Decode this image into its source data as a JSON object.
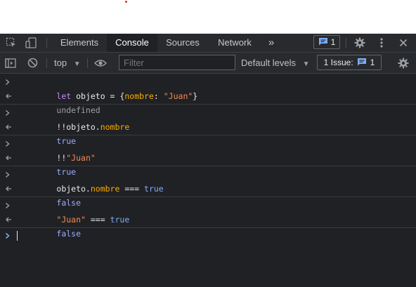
{
  "tabs": {
    "elements": "Elements",
    "console": "Console",
    "sources": "Sources",
    "network": "Network",
    "more": "»",
    "messages_count": "1"
  },
  "toolbar": {
    "context": "top",
    "filter_placeholder": "Filter",
    "levels": "Default levels",
    "issues_label": "1 Issue:",
    "issues_count": "1"
  },
  "console": {
    "entries": [
      {
        "input": {
          "t1": "let objeto = {",
          "t2": "nombre",
          "t3": ": ",
          "t4": "\"Juan\"",
          "t5": "}"
        },
        "output": "undefined"
      },
      {
        "input": {
          "t1": "!!objeto.",
          "t2": "nombre"
        },
        "output": "true"
      },
      {
        "input": {
          "t1": "!!",
          "t2": "\"Juan\""
        },
        "output": "true"
      },
      {
        "input": {
          "t1": "objeto.",
          "t2": "nombre",
          "t3": " === ",
          "t4": "true"
        },
        "output": "false"
      },
      {
        "input": {
          "t1": "\"Juan\"",
          "t2": " === ",
          "t3": "true"
        },
        "output": "false"
      }
    ]
  },
  "colors": {
    "panel_bg": "#202124",
    "toolbar_bg": "#292a2d",
    "string": "#f28b54",
    "property": "#f9ab00",
    "boolean": "#9cabff",
    "accent": "#7cacf8"
  },
  "icons": [
    "inspect-icon",
    "device-toggle-icon",
    "messages-icon",
    "settings-icon",
    "kebab-menu-icon",
    "close-icon",
    "sidebar-toggle-icon",
    "clear-console-icon",
    "eye-icon",
    "dropdown-arrow-icon",
    "issues-icon",
    "console-settings-icon",
    "input-chevron-icon",
    "result-arrow-icon",
    "prompt-chevron-icon"
  ]
}
